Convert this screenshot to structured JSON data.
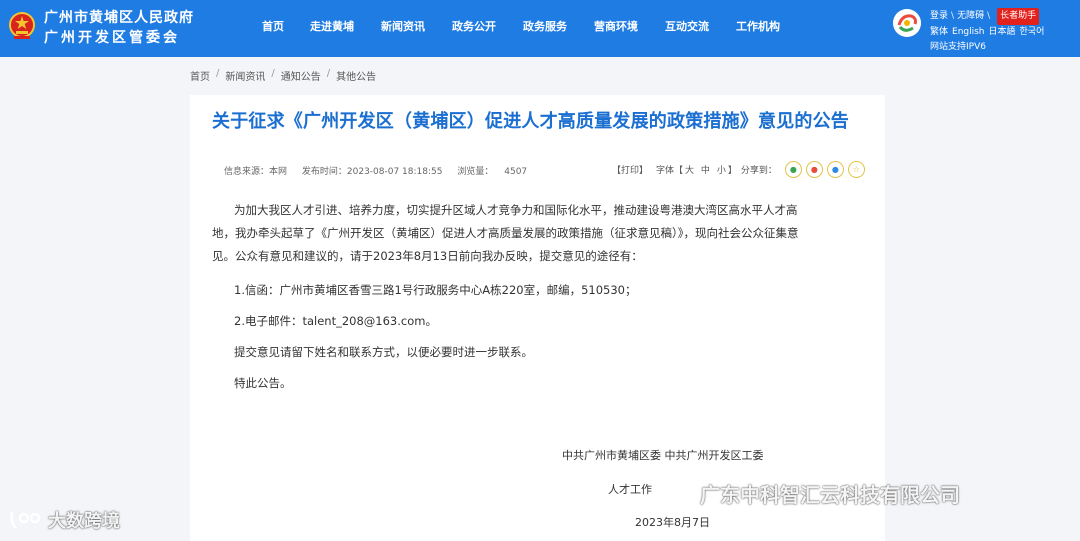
{
  "header": {
    "org_line1": "广州市黄埔区人民政府",
    "org_line2": "广州开发区管委会",
    "nav": [
      "首页",
      "走进黄埔",
      "新闻资讯",
      "政务公开",
      "政务服务",
      "营商环境",
      "互动交流",
      "工作机构"
    ],
    "login": "登录",
    "accessible": "无障碍",
    "elder": "长者助手",
    "langs": [
      "繁体",
      "English",
      "日本語",
      "한국어"
    ],
    "ipv6": "网站支持IPV6"
  },
  "breadcrumb": [
    "首页",
    "新闻资讯",
    "通知公告",
    "其他公告"
  ],
  "article": {
    "title": "关于征求《广州开发区（黄埔区）促进人才高质量发展的政策措施》意见的公告",
    "source": "信息来源：本网",
    "publish_time": "发布时间：2023-08-07 18:18:55",
    "views_label": "浏览量：",
    "views": "4507",
    "print": "【打印】",
    "font_label": "字体【",
    "font_large": "大",
    "font_medium": "中",
    "font_small": "小",
    "font_close": "】",
    "share_label": "分享到：",
    "paragraphs": [
      "为加大我区人才引进、培养力度，切实提升区域人才竞争力和国际化水平，推动建设粤港澳大湾区高水平人才高地，我办牵头起草了《广州开发区（黄埔区）促进人才高质量发展的政策措施（征求意见稿）》，现向社会公众征集意见。公众有意见和建议的，请于2023年8月13日前向我办反映，提交意见的途径有：",
      "1.信函：广州市黄埔区香雪三路1号行政服务中心A栋220室，邮编，510530；",
      "2.电子邮件：talent_208@163.com。",
      "提交意见请留下姓名和联系方式，以便必要时进一步联系。",
      "特此公告。"
    ],
    "signature1": "中共广州市黄埔区委 中共广州开发区工委",
    "signature2": "人才工作",
    "date": "2023年8月7日"
  },
  "watermarks": {
    "left": "大数跨境",
    "right": "广东中科智汇云科技有限公司"
  },
  "colors": {
    "header_bg": "#1f7ce3",
    "title": "#1a6fd1",
    "elder_badge": "#e3211c"
  }
}
